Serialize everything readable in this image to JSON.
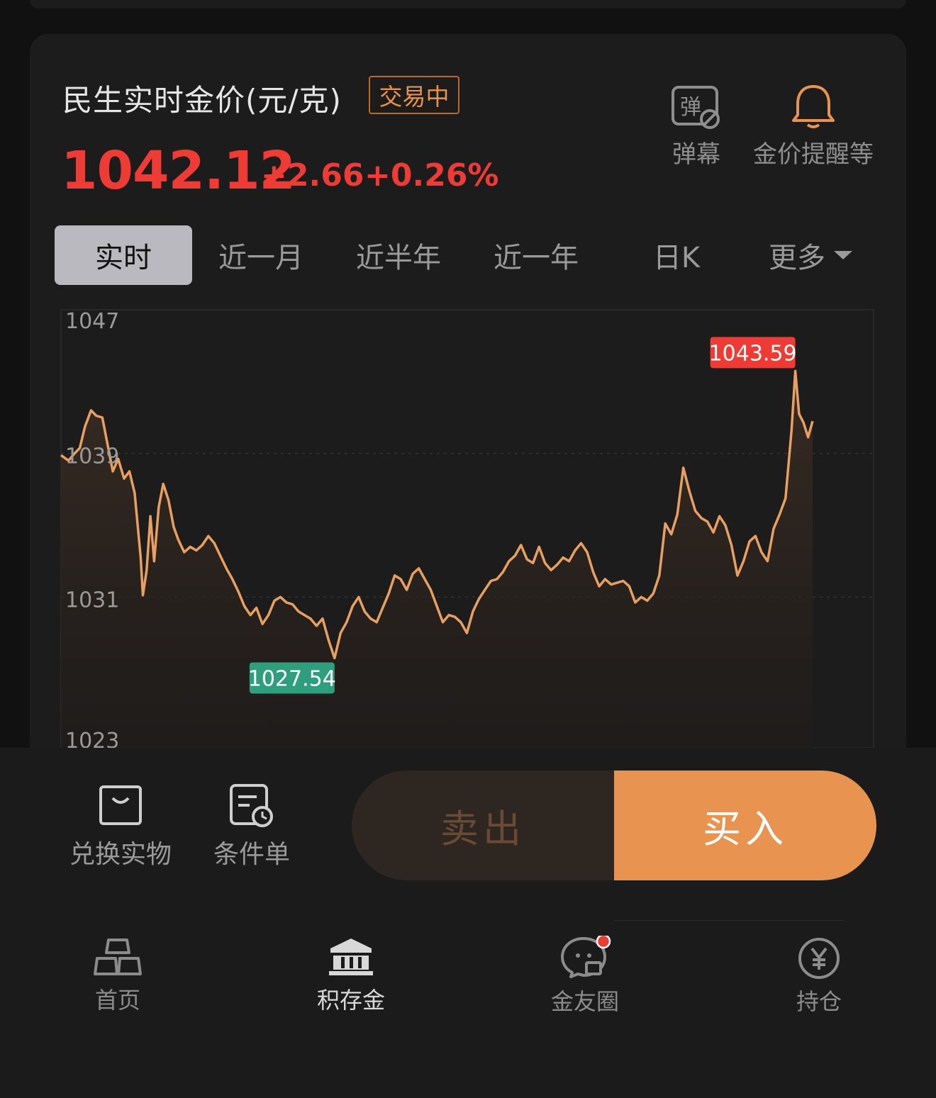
{
  "header": {
    "title": "民生实时金价(元/克)",
    "status_badge": "交易中",
    "price": "1042.12",
    "change": "+2.66",
    "change_pct": "+0.26%"
  },
  "tools": {
    "danmaku_label": "弹幕",
    "alert_label": "金价提醒等",
    "danmaku_icon_text": "弹"
  },
  "tabs": [
    "实时",
    "近一月",
    "近半年",
    "近一年",
    "日K",
    "更多"
  ],
  "active_tab": "实时",
  "colors": {
    "up": "#ee3b35",
    "down": "#2f9e7c",
    "line": "#e8a062",
    "accent": "#e8934f"
  },
  "chart_data": {
    "type": "line",
    "y_ticks": [
      "1047",
      "1039",
      "1031",
      "1023"
    ],
    "ylim": [
      1023,
      1047
    ],
    "high_label": "1043.59",
    "low_label": "1027.54",
    "xlim": [
      0,
      100
    ],
    "series": [
      {
        "points": [
          [
            0,
            1038.9
          ],
          [
            1.0,
            1038.6
          ],
          [
            1.8,
            1039.0
          ],
          [
            2.5,
            1039.3
          ],
          [
            3.2,
            1040.5
          ],
          [
            4.0,
            1041.4
          ],
          [
            4.7,
            1041.1
          ],
          [
            5.5,
            1041.0
          ],
          [
            6.2,
            1039.5
          ],
          [
            6.9,
            1038.0
          ],
          [
            7.6,
            1038.7
          ],
          [
            8.4,
            1037.6
          ],
          [
            9.1,
            1038.0
          ],
          [
            9.8,
            1036.8
          ],
          [
            10.6,
            1033.2
          ],
          [
            10.9,
            1031.1
          ],
          [
            11.4,
            1032.5
          ],
          [
            11.9,
            1035.5
          ],
          [
            12.4,
            1033.0
          ],
          [
            13.0,
            1036.0
          ],
          [
            13.6,
            1037.3
          ],
          [
            14.3,
            1036.4
          ],
          [
            15.0,
            1034.9
          ],
          [
            15.6,
            1034.2
          ],
          [
            16.4,
            1033.5
          ],
          [
            17.2,
            1033.8
          ],
          [
            18.0,
            1033.6
          ],
          [
            18.8,
            1033.9
          ],
          [
            19.6,
            1034.4
          ],
          [
            20.4,
            1034.0
          ],
          [
            21.2,
            1033.3
          ],
          [
            22.0,
            1032.6
          ],
          [
            22.8,
            1032.0
          ],
          [
            23.6,
            1031.3
          ],
          [
            24.4,
            1030.5
          ],
          [
            25.2,
            1030.0
          ],
          [
            26.0,
            1030.4
          ],
          [
            26.8,
            1029.5
          ],
          [
            27.6,
            1030.0
          ],
          [
            28.4,
            1030.8
          ],
          [
            29.2,
            1031.0
          ],
          [
            30.0,
            1030.7
          ],
          [
            30.8,
            1030.6
          ],
          [
            31.6,
            1030.2
          ],
          [
            32.4,
            1030.0
          ],
          [
            33.2,
            1029.8
          ],
          [
            34.0,
            1029.4
          ],
          [
            34.8,
            1029.8
          ],
          [
            35.6,
            1028.6
          ],
          [
            36.4,
            1027.6
          ],
          [
            37.2,
            1029.0
          ],
          [
            38.0,
            1029.6
          ],
          [
            38.8,
            1030.5
          ],
          [
            39.6,
            1031.0
          ],
          [
            40.4,
            1030.2
          ],
          [
            41.2,
            1029.8
          ],
          [
            42.0,
            1029.6
          ],
          [
            42.8,
            1030.4
          ],
          [
            43.6,
            1031.2
          ],
          [
            44.4,
            1032.2
          ],
          [
            45.2,
            1032.0
          ],
          [
            46.0,
            1031.4
          ],
          [
            46.8,
            1032.3
          ],
          [
            47.6,
            1032.6
          ],
          [
            48.4,
            1032.0
          ],
          [
            49.2,
            1031.4
          ],
          [
            50.0,
            1030.5
          ],
          [
            50.8,
            1029.6
          ],
          [
            51.6,
            1030.0
          ],
          [
            52.4,
            1029.9
          ],
          [
            53.2,
            1029.6
          ],
          [
            54.0,
            1029.0
          ],
          [
            54.8,
            1030.2
          ],
          [
            55.6,
            1030.9
          ],
          [
            56.4,
            1031.4
          ],
          [
            57.2,
            1031.9
          ],
          [
            58.0,
            1032.0
          ],
          [
            58.8,
            1032.4
          ],
          [
            59.6,
            1033.0
          ],
          [
            60.4,
            1033.3
          ],
          [
            61.2,
            1033.9
          ],
          [
            62.0,
            1033.1
          ],
          [
            62.8,
            1032.9
          ],
          [
            63.6,
            1033.8
          ],
          [
            64.4,
            1032.9
          ],
          [
            65.2,
            1032.5
          ],
          [
            66.0,
            1032.8
          ],
          [
            66.8,
            1033.2
          ],
          [
            67.6,
            1033.0
          ],
          [
            68.4,
            1033.6
          ],
          [
            69.2,
            1034.0
          ],
          [
            70.0,
            1033.5
          ],
          [
            70.8,
            1032.4
          ],
          [
            71.6,
            1031.6
          ],
          [
            72.4,
            1032.0
          ],
          [
            73.2,
            1031.7
          ],
          [
            74.0,
            1031.8
          ],
          [
            74.8,
            1031.9
          ],
          [
            75.6,
            1031.6
          ],
          [
            76.4,
            1030.7
          ],
          [
            77.2,
            1031.0
          ],
          [
            78.0,
            1030.8
          ],
          [
            78.8,
            1031.2
          ],
          [
            79.6,
            1032.2
          ],
          [
            80.4,
            1035.1
          ],
          [
            81.2,
            1034.5
          ],
          [
            82.0,
            1035.6
          ],
          [
            82.8,
            1038.2
          ],
          [
            83.6,
            1036.9
          ],
          [
            84.4,
            1035.8
          ],
          [
            85.2,
            1035.4
          ],
          [
            86.0,
            1035.2
          ],
          [
            86.8,
            1034.6
          ],
          [
            87.6,
            1035.5
          ],
          [
            88.4,
            1035.0
          ],
          [
            89.2,
            1033.9
          ],
          [
            90.0,
            1032.2
          ],
          [
            90.8,
            1033.0
          ],
          [
            91.6,
            1034.1
          ],
          [
            92.4,
            1034.4
          ],
          [
            93.2,
            1033.5
          ],
          [
            94.0,
            1033.0
          ],
          [
            94.8,
            1034.8
          ],
          [
            95.6,
            1035.6
          ],
          [
            96.4,
            1036.5
          ],
          [
            97.2,
            1040.3
          ],
          [
            97.7,
            1043.59
          ],
          [
            98.2,
            1041.2
          ],
          [
            98.8,
            1040.7
          ],
          [
            99.4,
            1039.9
          ],
          [
            100,
            1040.8
          ]
        ]
      }
    ]
  },
  "actions": {
    "redeem_label": "兑换实物",
    "conditional_label": "条件单",
    "sell_label": "卖出",
    "buy_label": "买入"
  },
  "nav": {
    "home": "首页",
    "accumulate": "积存金",
    "community": "金友圈",
    "holdings": "持仓",
    "active": "积存金"
  }
}
